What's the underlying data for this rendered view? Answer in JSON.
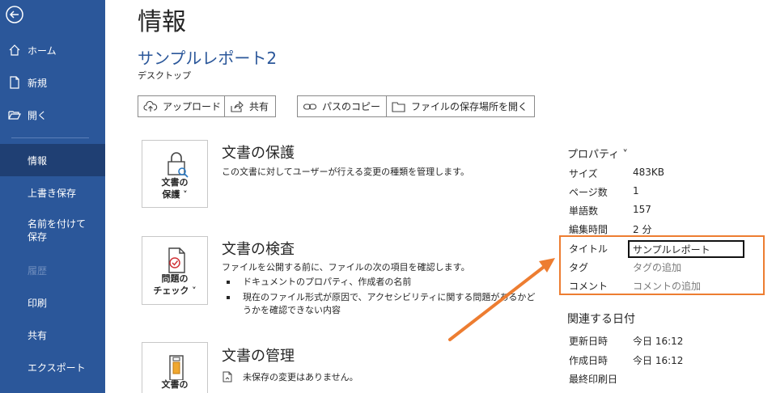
{
  "sidebar": {
    "items": [
      {
        "label": "ホーム"
      },
      {
        "label": "新規"
      },
      {
        "label": "開く"
      },
      {
        "label": "情報"
      },
      {
        "label": "上書き保存"
      },
      {
        "label": "名前を付けて保存"
      },
      {
        "label": "履歴"
      },
      {
        "label": "印刷"
      },
      {
        "label": "共有"
      },
      {
        "label": "エクスポート"
      }
    ]
  },
  "page": {
    "title": "情報",
    "doc_name": "サンプルレポート2",
    "doc_location": "デスクトップ"
  },
  "toolbar": {
    "upload": "アップロード",
    "share": "共有",
    "copy_path": "パスのコピー",
    "open_location": "ファイルの保存場所を開く"
  },
  "sections": {
    "protect": {
      "button_line1": "文書の",
      "button_line2": "保護 ˅",
      "title": "文書の保護",
      "desc": "この文書に対してユーザーが行える変更の種類を管理します。"
    },
    "inspect": {
      "button_line1": "問題の",
      "button_line2": "チェック ˅",
      "title": "文書の検査",
      "desc": "ファイルを公開する前に、ファイルの次の項目を確認します。",
      "bullets": [
        "ドキュメントのプロパティ、作成者の名前",
        "現在のファイル形式が原因で、アクセシビリティに関する問題があるかど",
        "うかを確認できない内容"
      ]
    },
    "manage": {
      "button_line1": "文書の",
      "title": "文書の管理",
      "desc": "未保存の変更はありません。"
    }
  },
  "properties": {
    "heading": "プロパティ ˅",
    "rows": [
      {
        "label": "サイズ",
        "value": "483KB"
      },
      {
        "label": "ページ数",
        "value": "1"
      },
      {
        "label": "単語数",
        "value": "157"
      },
      {
        "label": "編集時間",
        "value": "2 分"
      }
    ],
    "title_label": "タイトル",
    "title_value": "サンプルレポート",
    "tag_label": "タグ",
    "tag_placeholder": "タグの追加",
    "comment_label": "コメント",
    "comment_placeholder": "コメントの追加"
  },
  "dates": {
    "heading": "関連する日付",
    "rows": [
      {
        "label": "更新日時",
        "value": "今日 16:12"
      },
      {
        "label": "作成日時",
        "value": "今日 16:12"
      },
      {
        "label": "最終印刷日",
        "value": ""
      }
    ]
  },
  "colors": {
    "sidebar": "#2b579a",
    "sidebar_active": "#1f3f73",
    "accent_title": "#2b579a",
    "highlight": "#ed7d31"
  }
}
